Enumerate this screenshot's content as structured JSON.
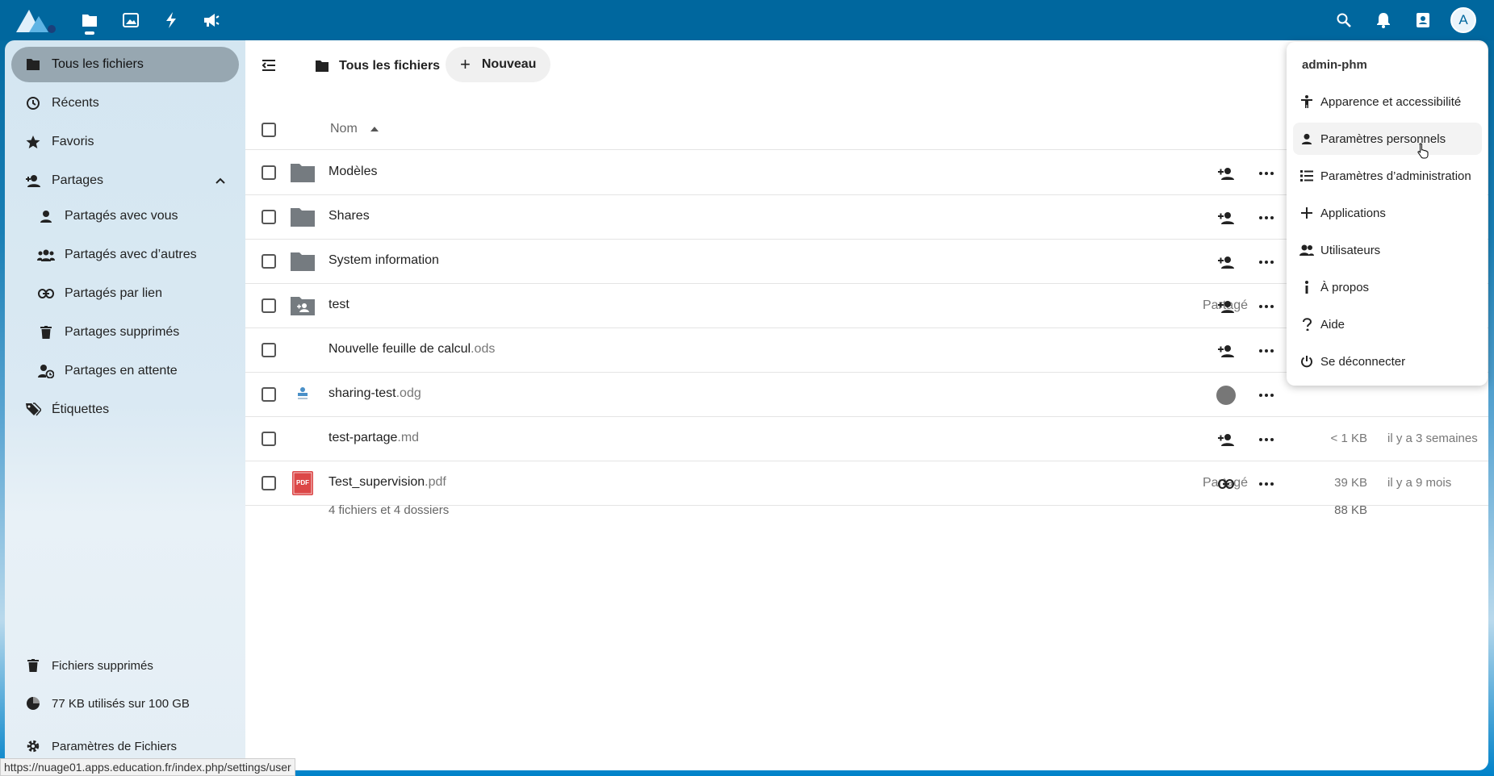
{
  "header": {
    "apps": [
      {
        "icon": "files-icon",
        "active": true
      },
      {
        "icon": "photos-icon",
        "active": false
      },
      {
        "icon": "activity-icon",
        "active": false
      },
      {
        "icon": "announcements-icon",
        "active": false
      }
    ],
    "right_icons": [
      "search-icon",
      "notifications-icon",
      "contacts-icon"
    ],
    "avatar_letter": "A"
  },
  "sidebar": {
    "items": [
      {
        "label": "Tous les fichiers",
        "icon": "folder-icon",
        "active": true
      },
      {
        "label": "Récents",
        "icon": "history-icon"
      },
      {
        "label": "Favoris",
        "icon": "star-icon"
      },
      {
        "label": "Partages",
        "icon": "share-icon"
      }
    ],
    "sub_items": [
      {
        "label": "Partagés avec vous",
        "icon": "person-icon"
      },
      {
        "label": "Partagés avec d’autres",
        "icon": "group-icon"
      },
      {
        "label": "Partagés par lien",
        "icon": "link-icon"
      },
      {
        "label": "Partages supprimés",
        "icon": "trash-icon"
      },
      {
        "label": "Partages en attente",
        "icon": "pending-icon"
      }
    ],
    "tags": {
      "label": "Étiquettes",
      "icon": "tag-icon"
    },
    "trash": "Fichiers supprimés",
    "quota": "77 KB utilisés sur 100 GB",
    "settings": "Paramètres de Fichiers"
  },
  "main": {
    "breadcrumb": "Tous les fichiers",
    "new_label": "Nouveau",
    "col_name": "Nom",
    "files": [
      {
        "name": "Modèles",
        "ext": "",
        "type": "folder",
        "shared": "",
        "share_icon": "share-add",
        "size": "",
        "mtime": ""
      },
      {
        "name": "Shares",
        "ext": "",
        "type": "folder",
        "shared": "",
        "share_icon": "share-add",
        "size": "",
        "mtime": ""
      },
      {
        "name": "System information",
        "ext": "",
        "type": "folder",
        "shared": "",
        "share_icon": "share-add",
        "size": "",
        "mtime": ""
      },
      {
        "name": "test",
        "ext": "",
        "type": "shared-folder",
        "shared": "Partagé",
        "share_icon": "share-add",
        "size": "",
        "mtime": ""
      },
      {
        "name": "Nouvelle feuille de calcul",
        "ext": ".ods",
        "type": "blank",
        "shared": "",
        "share_icon": "share-add",
        "size": "",
        "mtime": ""
      },
      {
        "name": "sharing-test",
        "ext": ".odg",
        "type": "odg",
        "shared": "",
        "share_icon": "avatar",
        "size": "",
        "mtime": ""
      },
      {
        "name": "test-partage",
        "ext": ".md",
        "type": "blank",
        "shared": "",
        "share_icon": "share-add",
        "size": "< 1 KB",
        "mtime": "il y a 3 semaines"
      },
      {
        "name": "Test_supervision",
        "ext": ".pdf",
        "type": "pdf",
        "shared": "Partagé",
        "share_icon": "link",
        "size": "39 KB",
        "mtime": "il y a 9 mois"
      }
    ],
    "summary": "4 fichiers et 4 dossiers",
    "summary_size": "88 KB",
    "pdf_badge": "PDF"
  },
  "menu": {
    "user": "admin-phm",
    "items": [
      {
        "label": "Apparence et accessibilité",
        "icon": "accessibility-icon"
      },
      {
        "label": "Paramètres personnels",
        "icon": "person-icon",
        "hover": true
      },
      {
        "label": "Paramètres d’administration",
        "icon": "admin-list-icon"
      },
      {
        "label": "Applications",
        "icon": "plus-icon"
      },
      {
        "label": "Utilisateurs",
        "icon": "users-icon"
      },
      {
        "label": "À propos",
        "icon": "info-icon"
      },
      {
        "label": "Aide",
        "icon": "help-icon"
      },
      {
        "label": "Se déconnecter",
        "icon": "power-icon"
      }
    ]
  },
  "status_url": "https://nuage01.apps.education.fr/index.php/settings/user"
}
